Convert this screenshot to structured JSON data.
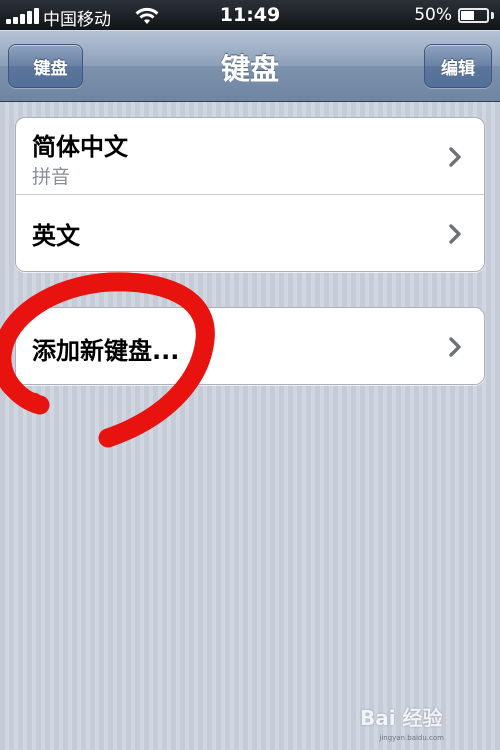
{
  "status_bar": {
    "carrier": "中国移动",
    "time": "11:49",
    "battery_percent": "50%",
    "battery_level": 0.5,
    "signal_bars": 5,
    "icons": [
      "signal-icon",
      "wifi-icon",
      "battery-icon"
    ]
  },
  "nav_bar": {
    "back_label": "键盘",
    "title": "键盘",
    "edit_label": "编辑"
  },
  "keyboards": [
    {
      "title": "简体中文",
      "subtitle": "拼音"
    },
    {
      "title": "英文",
      "subtitle": ""
    }
  ],
  "add_keyboard": {
    "label": "添加新键盘..."
  },
  "watermark": {
    "text": "Bai 经验",
    "url": "jingyan.baidu.com"
  },
  "colors": {
    "nav_bar": "#8da0b9",
    "annotation_red": "#e8130f",
    "background_stripes": "#cbd2dd"
  }
}
